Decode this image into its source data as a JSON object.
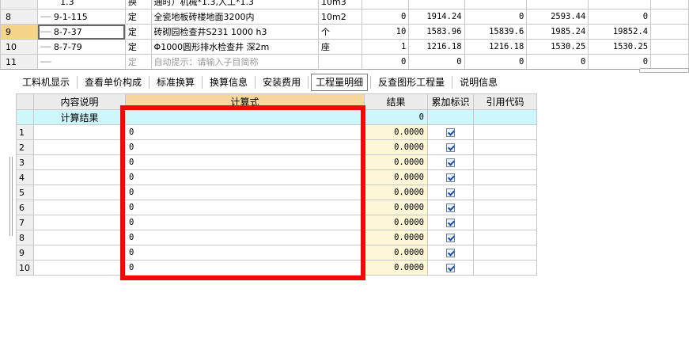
{
  "top_grid": {
    "rows": [
      {
        "num": "",
        "code": "1.3",
        "type": "换",
        "name": "通时）机械*1.3,人工*1.3",
        "unit": "10m3",
        "qty": "",
        "price": "",
        "amount": "",
        "price2": "",
        "amount2": ""
      },
      {
        "num": "8",
        "code": "9-1-115",
        "type": "定",
        "name": "全瓷地板砖楼地面3200内",
        "unit": "10m2",
        "qty": "0",
        "price": "1914.24",
        "amount": "0",
        "price2": "2593.44",
        "amount2": "0"
      },
      {
        "num": "9",
        "code": "8-7-37",
        "type": "定",
        "name": "砖砌园检查井S231 1000 h3",
        "unit": "个",
        "qty": "10",
        "price": "1583.96",
        "amount": "15839.6",
        "price2": "1985.24",
        "amount2": "19852.4"
      },
      {
        "num": "10",
        "code": "8-7-79",
        "type": "定",
        "name": "Φ1000圆形排水检查井 深2m",
        "unit": "座",
        "qty": "1",
        "price": "1216.18",
        "amount": "1216.18",
        "price2": "1530.25",
        "amount2": "1530.25"
      },
      {
        "num": "11",
        "code": "",
        "type": "定",
        "name": "自动提示：请输入子目简称",
        "unit": "",
        "qty": "0",
        "price": "0",
        "amount": "0",
        "price2": "0",
        "amount2": "0"
      }
    ]
  },
  "tabs": [
    {
      "label": "工料机显示"
    },
    {
      "label": "查看单价构成"
    },
    {
      "label": "标准换算"
    },
    {
      "label": "换算信息"
    },
    {
      "label": "安装费用"
    },
    {
      "label": "工程量明细"
    },
    {
      "label": "反查图形工程量"
    },
    {
      "label": "说明信息"
    }
  ],
  "detail_grid": {
    "headers": {
      "desc": "内容说明",
      "formula": "计算式",
      "result": "结果",
      "cumulative": "累加标识",
      "ref": "引用代码"
    },
    "summary": {
      "label": "计算结果",
      "formula": "",
      "result": "0"
    },
    "rows": [
      {
        "num": "1",
        "desc": "",
        "formula": "0",
        "result": "0.0000",
        "checked": true,
        "ref": ""
      },
      {
        "num": "2",
        "desc": "",
        "formula": "0",
        "result": "0.0000",
        "checked": true,
        "ref": ""
      },
      {
        "num": "3",
        "desc": "",
        "formula": "0",
        "result": "0.0000",
        "checked": true,
        "ref": ""
      },
      {
        "num": "4",
        "desc": "",
        "formula": "0",
        "result": "0.0000",
        "checked": true,
        "ref": ""
      },
      {
        "num": "5",
        "desc": "",
        "formula": "0",
        "result": "0.0000",
        "checked": true,
        "ref": ""
      },
      {
        "num": "6",
        "desc": "",
        "formula": "0",
        "result": "0.0000",
        "checked": true,
        "ref": ""
      },
      {
        "num": "7",
        "desc": "",
        "formula": "0",
        "result": "0.0000",
        "checked": true,
        "ref": ""
      },
      {
        "num": "8",
        "desc": "",
        "formula": "0",
        "result": "0.0000",
        "checked": true,
        "ref": ""
      },
      {
        "num": "9",
        "desc": "",
        "formula": "0",
        "result": "0.0000",
        "checked": true,
        "ref": ""
      },
      {
        "num": "10",
        "desc": "",
        "formula": "0",
        "result": "0.0000",
        "checked": true,
        "ref": ""
      }
    ]
  },
  "colors": {
    "highlight": "#ee0a0a",
    "selected_row_header": "#f5d58a",
    "summary_row": "#cdf7fb",
    "result_column": "#fdf7d8"
  }
}
